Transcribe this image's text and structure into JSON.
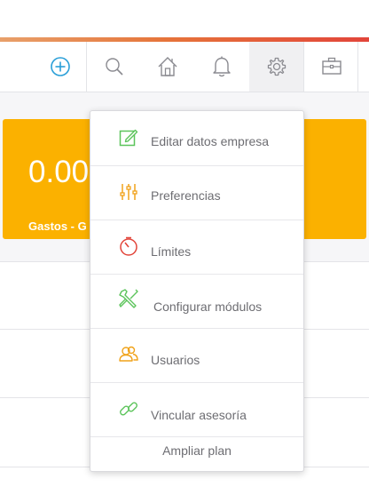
{
  "toolbar": {
    "icons": [
      {
        "name": "add-icon",
        "color": "#2a9fd8"
      },
      {
        "name": "search-icon",
        "color": "#8a8a90"
      },
      {
        "name": "home-icon",
        "color": "#8a8a90"
      },
      {
        "name": "bell-icon",
        "color": "#8a8a90"
      },
      {
        "name": "gear-icon",
        "color": "#8a8a90"
      },
      {
        "name": "briefcase-icon",
        "color": "#8a8a90"
      }
    ]
  },
  "card": {
    "amount": "0.00",
    "label": "Gastos - G",
    "color": "#fbb100"
  },
  "menu": {
    "items": [
      {
        "label": "Editar datos empresa",
        "icon": "edit-icon",
        "color": "#5cc45b"
      },
      {
        "label": "Preferencias",
        "icon": "sliders-icon",
        "color": "#f0a21a"
      },
      {
        "label": "Límites",
        "icon": "gauge-icon",
        "color": "#e2453a"
      },
      {
        "label": "Configurar módulos",
        "icon": "tools-icon",
        "color": "#5cc45b"
      },
      {
        "label": "Usuarios",
        "icon": "users-icon",
        "color": "#f0a21a"
      },
      {
        "label": "Vincular asesoría",
        "icon": "link-icon",
        "color": "#5cc45b"
      }
    ],
    "footer": "Ampliar plan"
  }
}
